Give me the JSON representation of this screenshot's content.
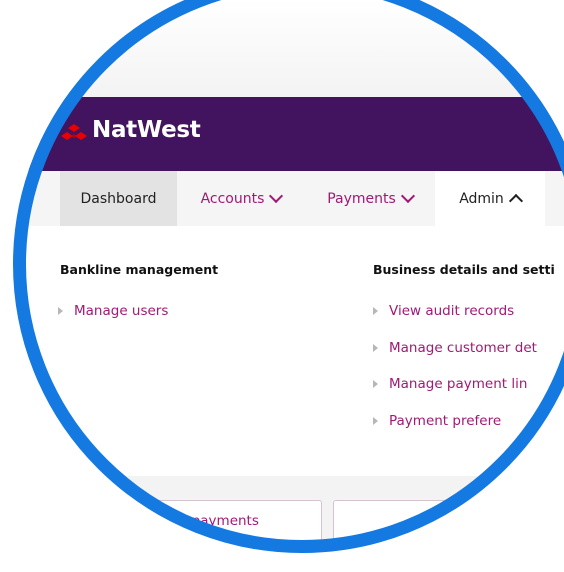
{
  "brand": {
    "name": "NatWest",
    "colors": {
      "header": "#42145f",
      "ring": "#1479e1",
      "link": "#a01a74"
    }
  },
  "nav": {
    "tabs": [
      {
        "label": "Dashboard",
        "state": "active"
      },
      {
        "label": "Accounts",
        "icon": "chevron-down-icon"
      },
      {
        "label": "Payments",
        "icon": "chevron-down-icon"
      },
      {
        "label": "Admin",
        "icon": "chevron-up-icon",
        "state": "open"
      }
    ]
  },
  "admin_menu": {
    "bankline_management": {
      "heading": "Bankline management",
      "links": [
        "Manage users"
      ]
    },
    "business_details": {
      "heading": "Business details and setti",
      "links": [
        "View audit records",
        "Manage customer det",
        "Manage payment lin",
        "Payment prefere"
      ]
    }
  },
  "bottom": {
    "card_label": "c payments"
  }
}
